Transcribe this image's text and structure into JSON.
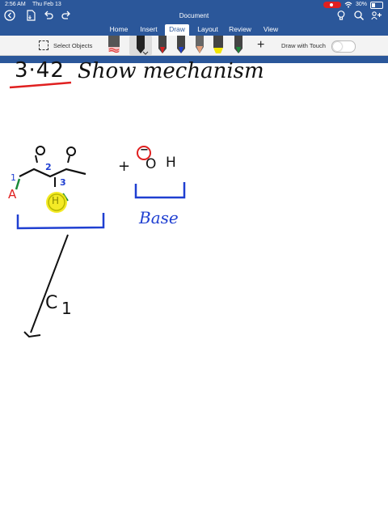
{
  "status": {
    "time": "2:56 AM",
    "date": "Thu Feb 13",
    "battery": "30%",
    "battery_level": 0.3
  },
  "app": {
    "title": "Document"
  },
  "tabs": [
    {
      "label": "Home",
      "active": false
    },
    {
      "label": "Insert",
      "active": false
    },
    {
      "label": "Draw",
      "active": true
    },
    {
      "label": "Layout",
      "active": false
    },
    {
      "label": "Review",
      "active": false
    },
    {
      "label": "View",
      "active": false
    }
  ],
  "ribbon": {
    "select_objects": "Select Objects",
    "draw_with_touch": "Draw with Touch",
    "draw_with_touch_on": false,
    "pens": [
      {
        "name": "pencil-red-pen",
        "color": "#e23a3a"
      },
      {
        "name": "pen-black",
        "color": "#111111",
        "selected": true
      },
      {
        "name": "pen-red",
        "color": "#d92020"
      },
      {
        "name": "pen-blue",
        "color": "#1f3fd1"
      },
      {
        "name": "pencil-orange",
        "color": "#e6a07a"
      },
      {
        "name": "highlighter-yellow",
        "color": "#f2e600"
      },
      {
        "name": "pen-green",
        "color": "#1b8a3a"
      }
    ]
  },
  "canvas": {
    "heading_number": "3·42",
    "heading_text": "Show mechanism",
    "labels": {
      "carbon_1": "1",
      "carbon_2": "2",
      "carbon_3": "3",
      "acidic_h": "A",
      "proton": "H",
      "hydroxide_o": "O",
      "hydroxide_h": "H",
      "charge": "−",
      "plus": "+",
      "base": "Base",
      "step": "C",
      "step_sub": "1"
    },
    "ink_colors": {
      "black": "#111111",
      "red": "#e02020",
      "blue": "#1f3fd1",
      "green": "#1b8a3a",
      "highlight": "#f2e600"
    }
  }
}
